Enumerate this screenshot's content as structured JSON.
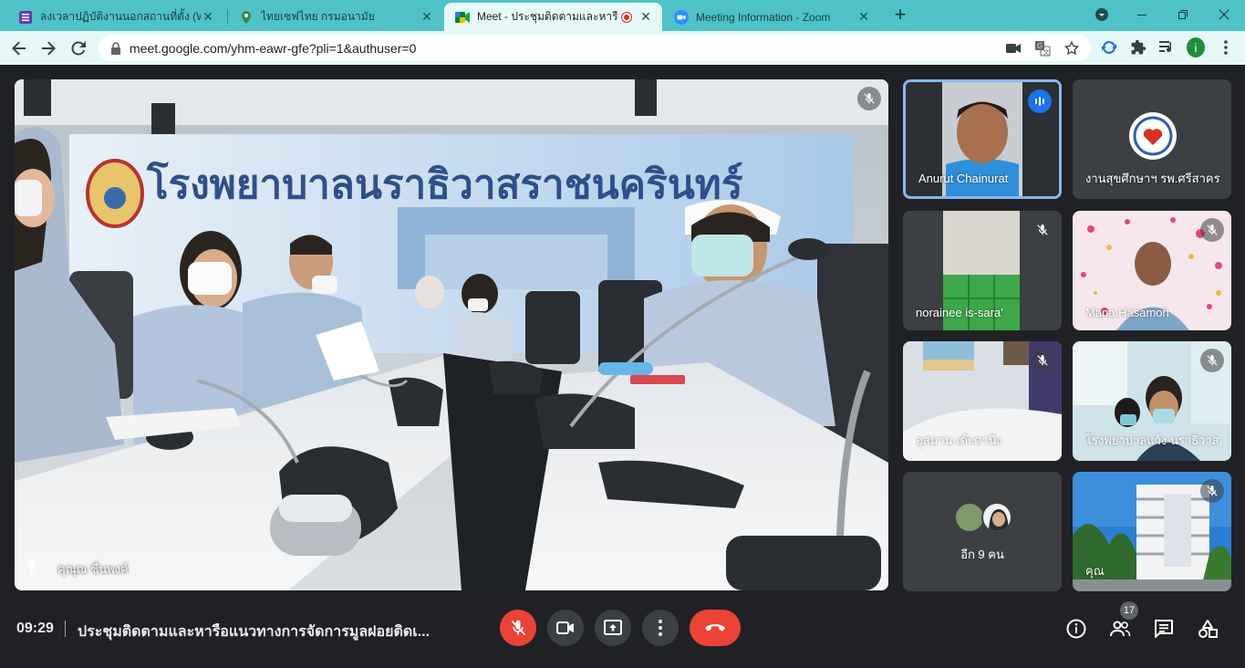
{
  "browser": {
    "tabs": [
      {
        "title": "ลงเวลาปฏิบัติงานนอกสถานที่ตั้ง (Work"
      },
      {
        "title": "ไทยเซฟไทย กรมอนามัย"
      },
      {
        "title": "Meet - ประชุมติดตามและหารือแน"
      },
      {
        "title": "Meeting Information - Zoom"
      }
    ],
    "url": "meet.google.com/yhm-eawr-gfe?pli=1&authuser=0",
    "profile_initial": "i"
  },
  "meet": {
    "main_speaker": "คุณุณ ชื่นพงค์",
    "tiles": [
      {
        "name": "Anurut Chainurat"
      },
      {
        "name": "งานสุขศึกษาฯ รพ.ศรีสาคร"
      },
      {
        "name": "norainee is-sara'"
      },
      {
        "name": "Mana Hasamoh"
      },
      {
        "name": "อุสมาน เด๊ะดานิ่ง"
      },
      {
        "name": "โรงพยาบาลแว้ง นราธิวาส"
      },
      {
        "name": "อีก 9 คน"
      },
      {
        "name": "คุณ"
      }
    ],
    "clock": "09:29",
    "meeting_title": "ประชุมติดตามและหารือแนวทางการจัดการมูลฝอยติดเ...",
    "participant_count": "17",
    "hospital_sign": "โรงพยาบาลนราธิวาสราชนครินทร์"
  }
}
